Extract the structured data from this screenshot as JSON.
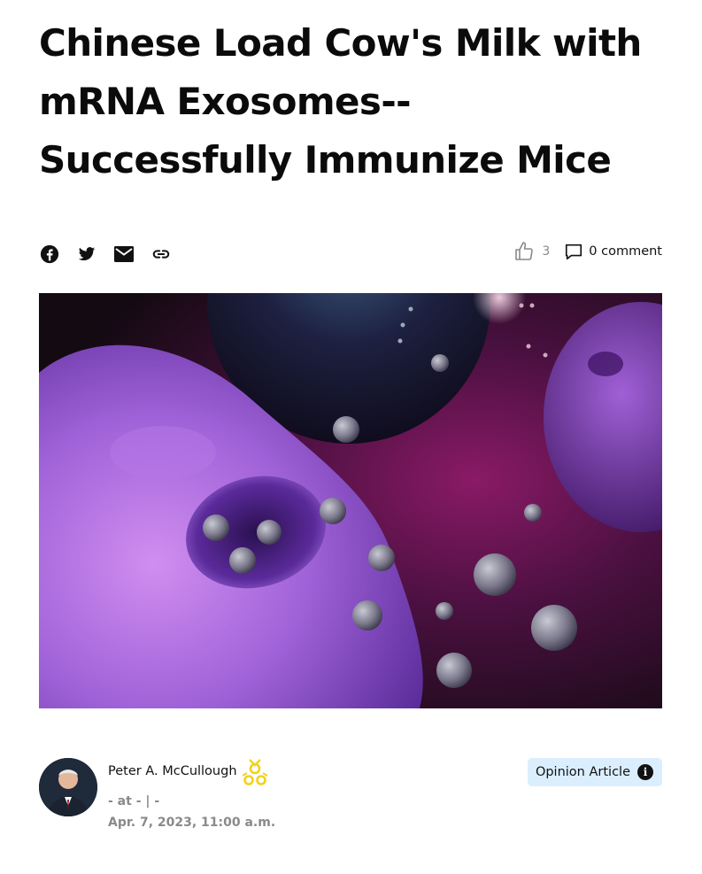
{
  "article": {
    "title": "Chinese Load Cow's Milk with mRNA Exosomes--Successfully Immunize Mice"
  },
  "share": {
    "icons": [
      "facebook-icon",
      "twitter-icon",
      "email-icon",
      "link-icon"
    ]
  },
  "engagement": {
    "likes": "3",
    "comments": "0 comment"
  },
  "hero_image": {
    "subject": "purple cells surrounded by exosome particles"
  },
  "author": {
    "name": "Peter A. McCullough",
    "meta": "- at - | -",
    "date": "Apr. 7, 2023, 11:00 a.m."
  },
  "tag": {
    "label": "Opinion Article",
    "info_icon": "i"
  },
  "colors": {
    "tag_bg": "#dbeefd",
    "muted_text": "#8a8a8a",
    "badge_gold": "#f2d21b"
  }
}
